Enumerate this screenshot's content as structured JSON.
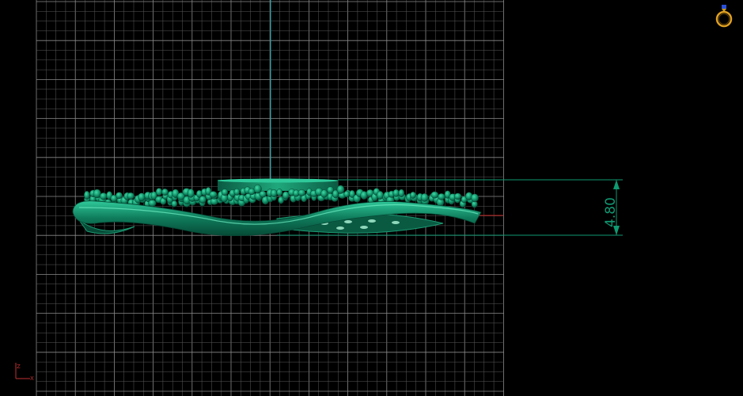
{
  "view": {
    "dimension": {
      "value": "4.80"
    },
    "axis_labels": {
      "z": "Z",
      "x": "X"
    },
    "colors": {
      "background": "#000000",
      "grid_minor": "#5a5a5a",
      "grid_major": "#8a8a8a",
      "model": "#0f7a5a",
      "model_highlight": "#2fc99a",
      "dimension": "#0f9a72",
      "axis_vertical": "#1aa0a8",
      "axis_horizontal": "#c02020"
    },
    "icons": {
      "view_cube": "ring-icon"
    }
  }
}
